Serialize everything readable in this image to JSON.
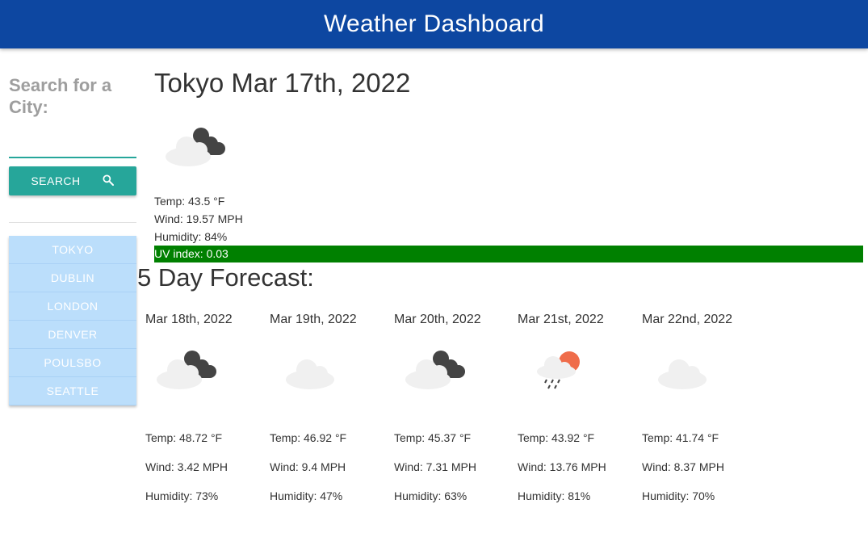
{
  "header": {
    "title": "Weather Dashboard"
  },
  "colors": {
    "header_bg": "#0d47a1",
    "accent": "#26a69a",
    "city_button": "#bbdefb",
    "uv_low": "#008000"
  },
  "sidebar": {
    "search_title": "Search for a City:",
    "search_input_value": "",
    "search_button": {
      "label": "SEARCH",
      "icon": "search-icon"
    },
    "cities": [
      "TOKYO",
      "DUBLIN",
      "LONDON",
      "DENVER",
      "POULSBO",
      "SEATTLE"
    ]
  },
  "current": {
    "city_date": "Tokyo Mar 17th, 2022",
    "icon": "cloud-moon-icon",
    "temp": "Temp: 43.5 °F",
    "wind": "Wind: 19.57 MPH",
    "humidity": "Humidity: 84%",
    "uv": "UV index: 0.03"
  },
  "forecast": {
    "title": "5 Day Forecast:",
    "days": [
      {
        "date": "Mar 18th, 2022",
        "icon": "cloud-moon-icon",
        "temp": "Temp: 48.72 °F",
        "wind": "Wind: 3.42 MPH",
        "humidity": "Humidity: 73%"
      },
      {
        "date": "Mar 19th, 2022",
        "icon": "cloud-icon",
        "temp": "Temp: 46.92 °F",
        "wind": "Wind: 9.4 MPH",
        "humidity": "Humidity: 47%"
      },
      {
        "date": "Mar 20th, 2022",
        "icon": "cloud-moon-icon",
        "temp": "Temp: 45.37 °F",
        "wind": "Wind: 7.31 MPH",
        "humidity": "Humidity: 63%"
      },
      {
        "date": "Mar 21st, 2022",
        "icon": "sun-cloud-rain-icon",
        "temp": "Temp: 43.92 °F",
        "wind": "Wind: 13.76 MPH",
        "humidity": "Humidity: 81%"
      },
      {
        "date": "Mar 22nd, 2022",
        "icon": "cloud-icon",
        "temp": "Temp: 41.74 °F",
        "wind": "Wind: 8.37 MPH",
        "humidity": "Humidity: 70%"
      }
    ]
  }
}
